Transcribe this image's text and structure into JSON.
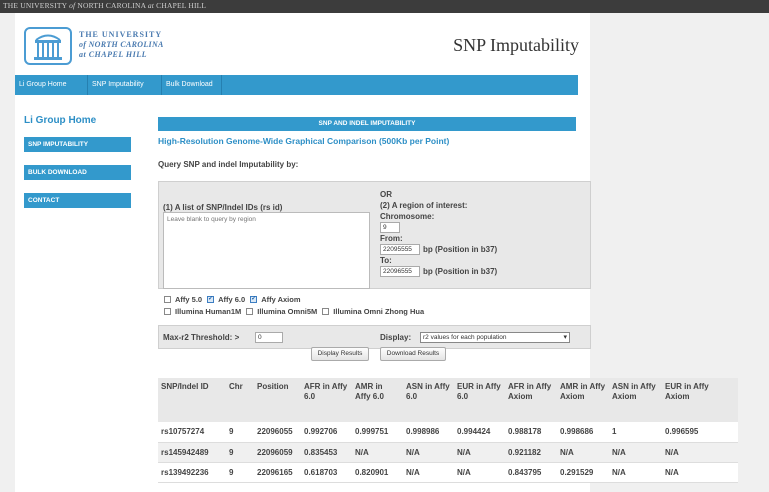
{
  "topbar": {
    "pre": "THE UNIVERSITY",
    "of": "of",
    "mid": "NORTH CAROLINA",
    "at": "at",
    "post": "CHAPEL HILL"
  },
  "logo": {
    "line1": "THE UNIVERSITY",
    "line2": "of NORTH CAROLINA",
    "line3": "at CHAPEL HILL"
  },
  "site_title": "SNP Imputability",
  "nav": [
    "Li Group Home",
    "SNP Imputability",
    "Bulk Download"
  ],
  "sidebar": {
    "title": "Li Group Home",
    "items": [
      "SNP IMPUTABILITY",
      "BULK DOWNLOAD",
      "CONTACT"
    ]
  },
  "section_title": "SNP AND INDEL IMPUTABILITY",
  "subtitle": "High-Resolution Genome-Wide Graphical Comparison (500Kb per Point)",
  "query_label": "Query SNP and indel Imputability by:",
  "form": {
    "list_label": "(1) A list of SNP/Indel IDs (rs id)",
    "list_placeholder": "Leave blank to query by region",
    "or": "OR",
    "region_label": "(2) A region of interest:",
    "chrom_label": "Chromosome:",
    "chrom_value": "9",
    "from_label": "From:",
    "from_value": "22095555",
    "from_unit": "bp (Position in b37)",
    "to_label": "To:",
    "to_value": "22096555",
    "to_unit": "bp (Position in b37)"
  },
  "arrays": [
    {
      "label": "Affy 5.0",
      "checked": false
    },
    {
      "label": "Affy 6.0",
      "checked": true
    },
    {
      "label": "Affy Axiom",
      "checked": true
    },
    {
      "label": "Illumina Human1M",
      "checked": false
    },
    {
      "label": "Illumina Omni5M",
      "checked": false
    },
    {
      "label": "Illumina Omni Zhong Hua",
      "checked": false
    }
  ],
  "threshold": {
    "label": "Max-r2 Threshold: >",
    "value": "0"
  },
  "display": {
    "label": "Display:",
    "selected": "r2 values for each population"
  },
  "buttons": {
    "display": "Display Results",
    "download": "Download Results"
  },
  "table": {
    "headers": [
      "SNP/Indel ID",
      "Chr",
      "Position",
      "AFR in Affy 6.0",
      "AMR in Affy 6.0",
      "ASN in Affy 6.0",
      "EUR in Affy 6.0",
      "AFR in Affy Axiom",
      "AMR in Affy Axiom",
      "ASN in Affy Axiom",
      "EUR in Affy Axiom"
    ],
    "rows": [
      [
        "rs10757274",
        "9",
        "22096055",
        "0.992706",
        "0.999751",
        "0.998986",
        "0.994424",
        "0.988178",
        "0.998686",
        "1",
        "0.996595"
      ],
      [
        "rs145942489",
        "9",
        "22096059",
        "0.835453",
        "N/A",
        "N/A",
        "N/A",
        "0.921182",
        "N/A",
        "N/A",
        "N/A"
      ],
      [
        "rs139492236",
        "9",
        "22096165",
        "0.618703",
        "0.820901",
        "N/A",
        "N/A",
        "0.843795",
        "0.291529",
        "N/A",
        "N/A"
      ]
    ]
  },
  "colors": {
    "accent": "#3399cc",
    "title_blue": "#2d8fc6"
  }
}
